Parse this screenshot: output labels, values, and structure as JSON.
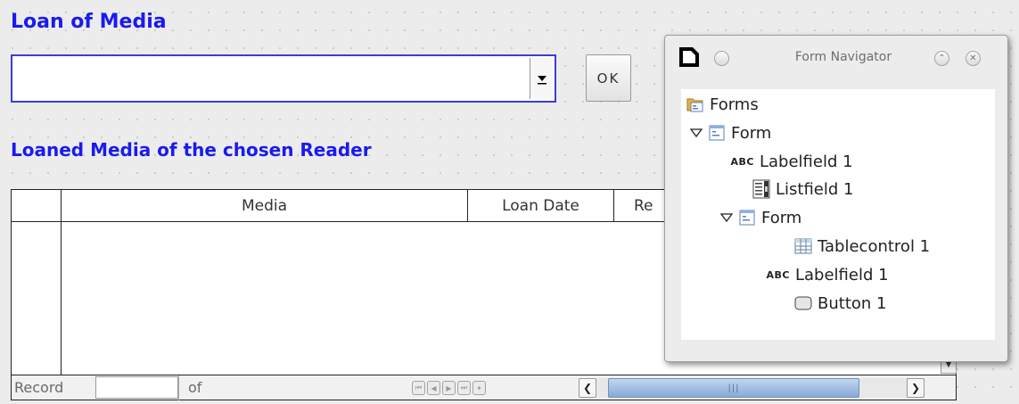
{
  "form": {
    "title": "Loan of Media",
    "subtitle": "Loaned Media of the chosen Reader",
    "reader_list": {
      "value": ""
    },
    "ok_label": "OK"
  },
  "table": {
    "columns": [
      {
        "label": "Media"
      },
      {
        "label": "Loan Date"
      },
      {
        "label": "Re"
      }
    ],
    "navigation": {
      "record_label": "Record",
      "record_value": "",
      "of_label": "of"
    }
  },
  "navigator": {
    "title": "Form Navigator",
    "tree": [
      {
        "label": "Forms",
        "icon": "forms-folder-icon"
      },
      {
        "label": "Form",
        "icon": "form-icon",
        "expanded": true
      },
      {
        "label": "Labelfield 1",
        "icon": "label-field-icon",
        "icon_text": "ABC"
      },
      {
        "label": "Listfield 1",
        "icon": "list-field-icon"
      },
      {
        "label": "Form",
        "icon": "form-icon",
        "expanded": true
      },
      {
        "label": "Tablecontrol 1",
        "icon": "table-control-icon"
      },
      {
        "label": "Labelfield 1",
        "icon": "label-field-icon",
        "icon_text": "ABC"
      },
      {
        "label": "Button 1",
        "icon": "button-icon"
      }
    ]
  },
  "colors": {
    "heading": "#1a1aef",
    "background": "#ececec",
    "scroll_thumb": "#9fbbe3"
  }
}
